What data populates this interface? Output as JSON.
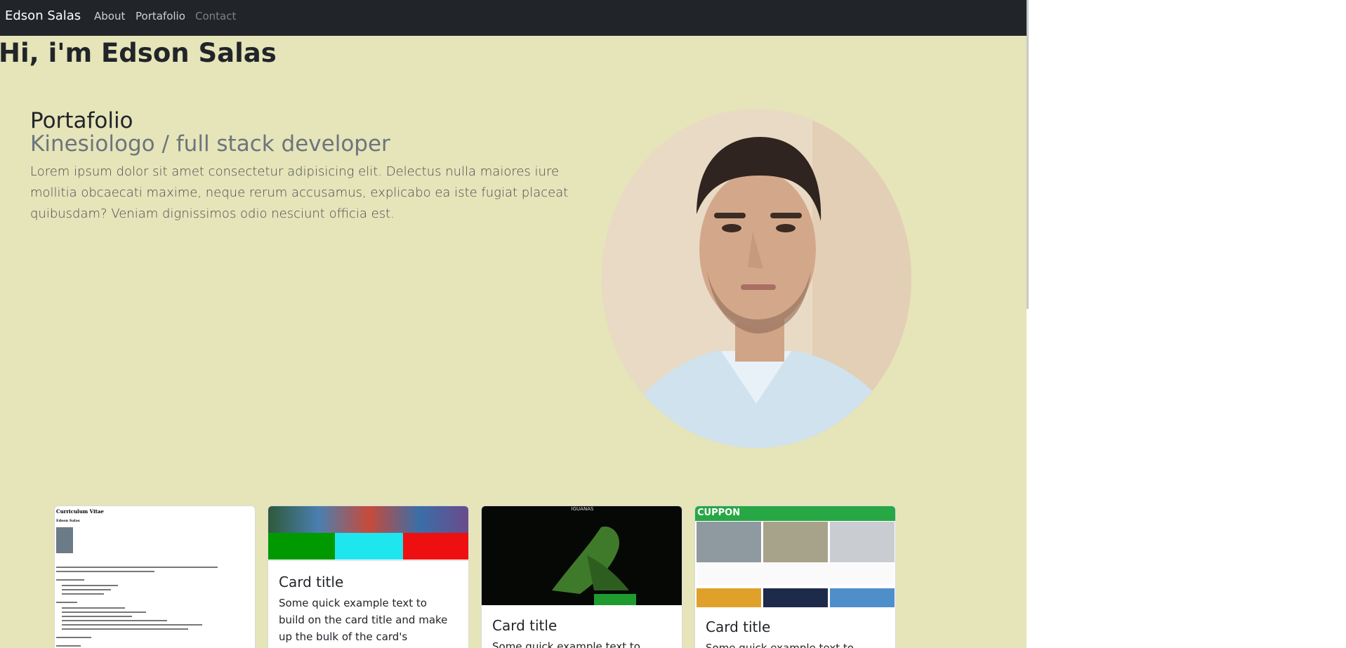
{
  "nav": {
    "brand": "Edson Salas",
    "links": [
      {
        "label": "About"
      },
      {
        "label": "Portafolio"
      },
      {
        "label": "Contact"
      }
    ]
  },
  "page": {
    "heading": "Hi, i'm Edson Salas"
  },
  "hero": {
    "title": "Portafolio",
    "subtitle": "Kinesiologo / full stack developer",
    "text": "Lorem ipsum dolor sit amet consectetur adipisicing elit. Delectus nulla maiores iure mollitia obcaecati maxime, neque rerum accusamus, explicabo ea iste fugiat placeat quibusdam? Veniam dignissimos odio nesciunt officia est."
  },
  "cards": [
    {
      "thumb_title": "Curriculum Vitae",
      "thumb_name": "Edson Salas"
    },
    {
      "title": "Card title",
      "text": "Some quick example text to build on the card title and make up the bulk of the card's content."
    },
    {
      "thumb_label": "IGUANAS",
      "title": "Card title",
      "text": "Some quick example text to build"
    },
    {
      "thumb_brand": "CUPPON",
      "title": "Card title",
      "text": "Some quick example text to build"
    }
  ],
  "colors": {
    "navbar": "#212529",
    "page_bg": "#e6e4b9",
    "cuppon_green": "#28a745"
  }
}
